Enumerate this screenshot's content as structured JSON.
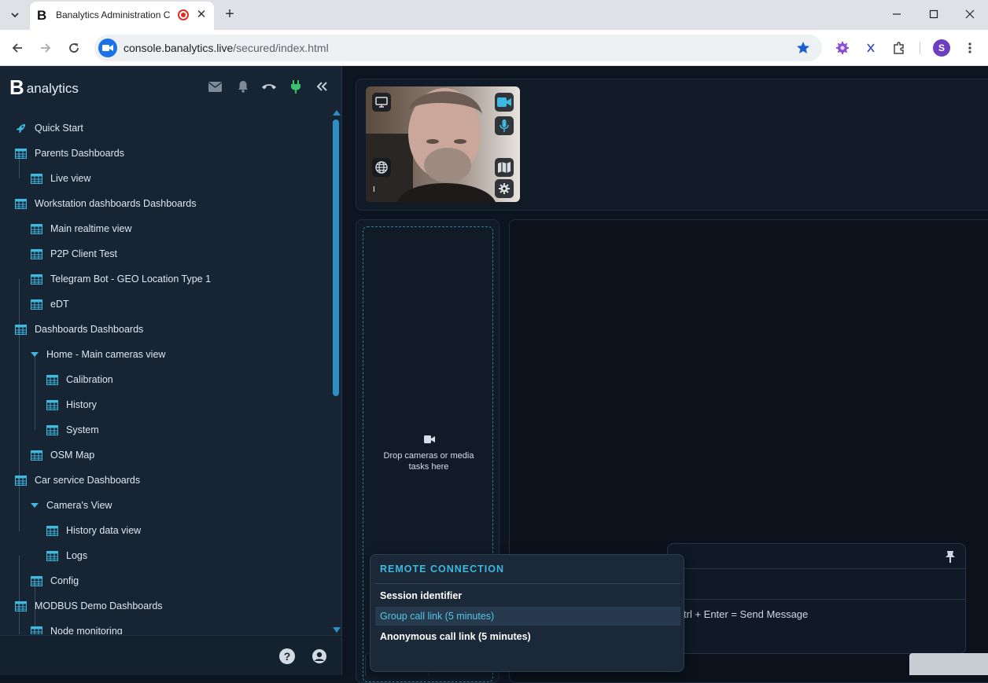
{
  "browser": {
    "tab_title": "Banalytics Administration C",
    "url_host": "console.banalytics.live",
    "url_path": "/secured/index.html",
    "profile_initial": "S"
  },
  "sidebar": {
    "brand_letter": "B",
    "brand_text": "analytics",
    "items": [
      {
        "label": "Quick Start"
      },
      {
        "label": "Parents Dashboards"
      },
      {
        "label": "Live view"
      },
      {
        "label": "Workstation dashboards Dashboards"
      },
      {
        "label": "Main realtime view"
      },
      {
        "label": "P2P Client Test"
      },
      {
        "label": "Telegram Bot - GEO Location Type 1"
      },
      {
        "label": "eDT"
      },
      {
        "label": "Dashboards Dashboards"
      },
      {
        "label": "Home - Main cameras view"
      },
      {
        "label": "Calibration"
      },
      {
        "label": "History"
      },
      {
        "label": "System"
      },
      {
        "label": "OSM Map"
      },
      {
        "label": "Car service Dashboards"
      },
      {
        "label": "Camera's View"
      },
      {
        "label": "History data view"
      },
      {
        "label": "Logs"
      },
      {
        "label": "Config"
      },
      {
        "label": "MODBUS Demo Dashboards"
      },
      {
        "label": "Node monitoring"
      }
    ],
    "footer": {
      "help_glyph": "?"
    }
  },
  "main": {
    "video_tile_label": "I",
    "drop_text": "Drop cameras or media tasks here",
    "chat_hint": "trl + Enter = Send Message"
  },
  "remote_menu": {
    "title": "REMOTE CONNECTION",
    "items": [
      {
        "label": "Session identifier"
      },
      {
        "label": "Group call link (5 minutes)"
      },
      {
        "label": "Anonymous call link (5 minutes)"
      }
    ]
  },
  "colors": {
    "accent": "#3fb8df",
    "sidebar_bg": "#162433",
    "plug_green": "#39c46a"
  }
}
